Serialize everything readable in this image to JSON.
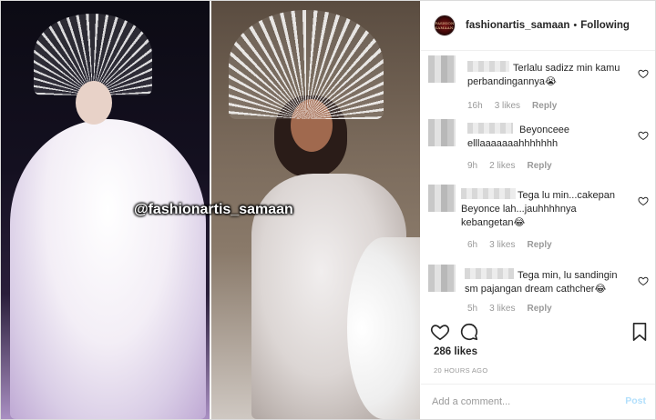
{
  "post": {
    "image": {
      "watermark": "@fashionartis_samaan"
    },
    "header": {
      "avatar_text": "FASHION SAMAAN",
      "username": "fashionartis_samaan",
      "separator": "•",
      "follow_status": "Following"
    },
    "comments": [
      {
        "text": "Terlalu sadizz min kamu perbandingannya😭",
        "time": "16h",
        "likes": "3 likes",
        "reply": "Reply"
      },
      {
        "text": "Beyonceee elllaaaaaaahhhhhhh",
        "time": "9h",
        "likes": "2 likes",
        "reply": "Reply"
      },
      {
        "text": "Tega lu min...cakepan Beyonce lah...jauhhhhnya kebangetan😂",
        "time": "6h",
        "likes": "3 likes",
        "reply": "Reply"
      },
      {
        "text": "Tega min, lu sandingin sm pajangan dream cathcher😂",
        "time": "5h",
        "likes": "3 likes",
        "reply": "Reply"
      }
    ],
    "likes_count": "286 likes",
    "posted_time": "20 HOURS AGO",
    "add_comment": {
      "placeholder": "Add a comment...",
      "post_label": "Post"
    }
  }
}
